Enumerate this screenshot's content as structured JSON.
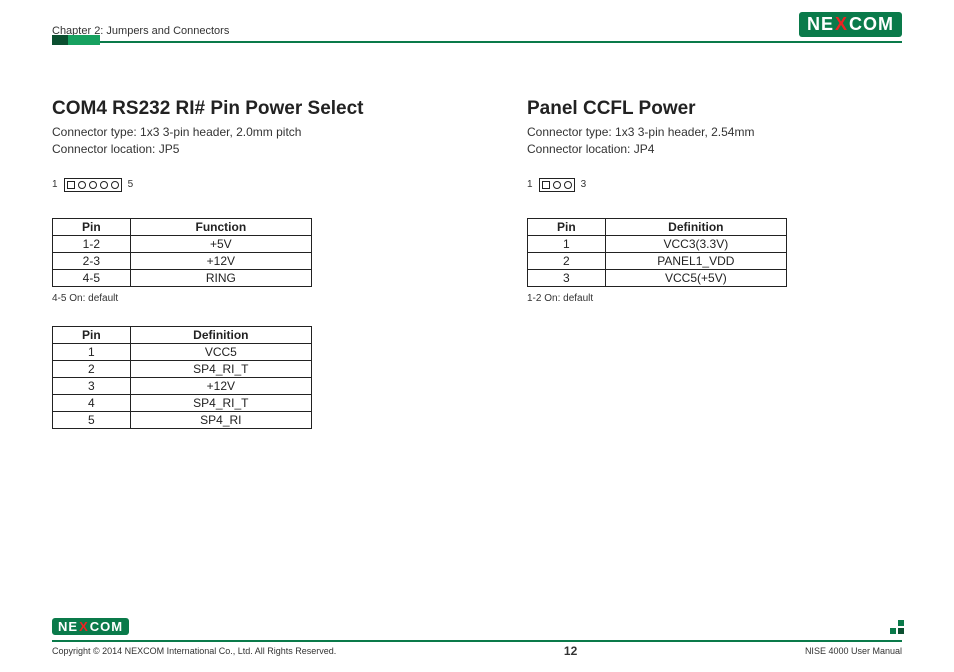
{
  "header": {
    "chapter": "Chapter 2: Jumpers and Connectors",
    "logo_pre": "NE",
    "logo_mid": "X",
    "logo_post": "COM"
  },
  "left": {
    "title": "COM4 RS232 RI# Pin Power Select",
    "conn_type": "Connector type: 1x3 3-pin header, 2.0mm pitch",
    "conn_loc": "Connector location: JP5",
    "conn_start": "1",
    "conn_end": "5",
    "conn_pins": 5,
    "table1": {
      "head_pin": "Pin",
      "head_fn": "Function",
      "rows": [
        {
          "pin": "1-2",
          "fn": "+5V"
        },
        {
          "pin": "2-3",
          "fn": "+12V"
        },
        {
          "pin": "4-5",
          "fn": "RING"
        }
      ],
      "note": "4-5 On: default"
    },
    "table2": {
      "head_pin": "Pin",
      "head_def": "Definition",
      "rows": [
        {
          "pin": "1",
          "def": "VCC5"
        },
        {
          "pin": "2",
          "def": "SP4_RI_T"
        },
        {
          "pin": "3",
          "def": "+12V"
        },
        {
          "pin": "4",
          "def": "SP4_RI_T"
        },
        {
          "pin": "5",
          "def": "SP4_RI"
        }
      ]
    }
  },
  "right": {
    "title": "Panel CCFL Power",
    "conn_type": "Connector type: 1x3 3-pin header, 2.54mm",
    "conn_loc": "Connector location: JP4",
    "conn_start": "1",
    "conn_end": "3",
    "conn_pins": 3,
    "table": {
      "head_pin": "Pin",
      "head_def": "Definition",
      "rows": [
        {
          "pin": "1",
          "def": "VCC3(3.3V)"
        },
        {
          "pin": "2",
          "def": "PANEL1_VDD"
        },
        {
          "pin": "3",
          "def": "VCC5(+5V)"
        }
      ],
      "note": "1-2 On: default"
    }
  },
  "footer": {
    "copyright": "Copyright © 2014 NEXCOM International Co., Ltd. All Rights Reserved.",
    "page": "12",
    "manual": "NISE 4000 User Manual"
  }
}
